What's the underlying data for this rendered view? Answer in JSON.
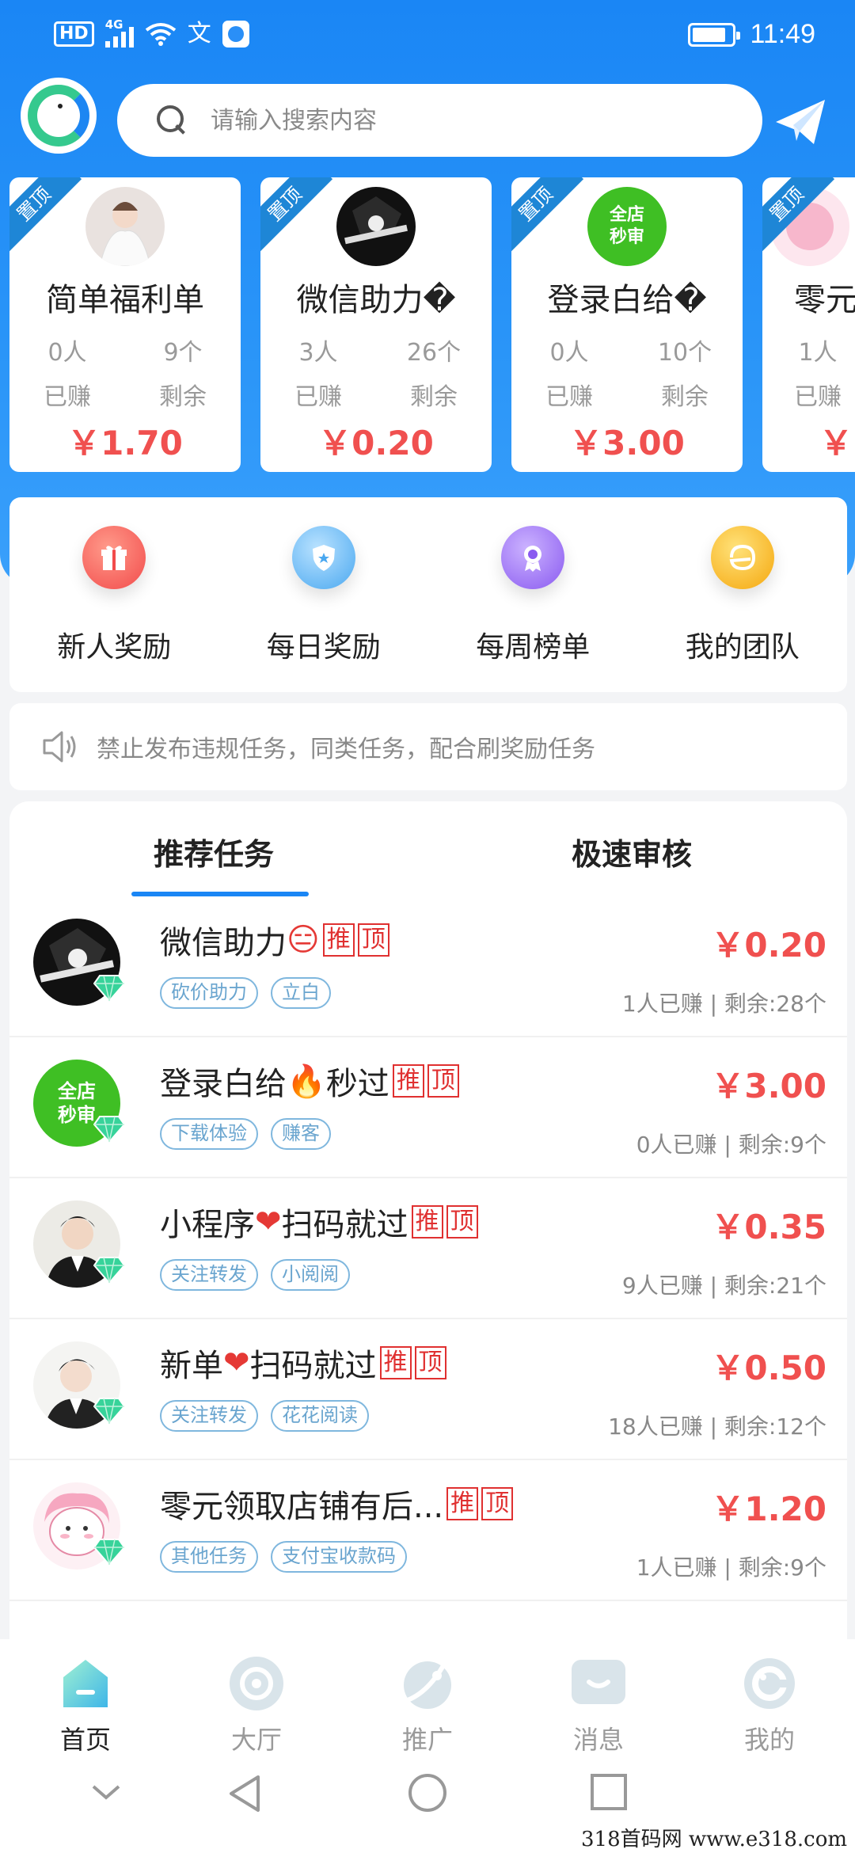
{
  "status_bar": {
    "hd": "HD",
    "network": "4G",
    "ime": "文",
    "time": "11:49",
    "battery_level": 0.85
  },
  "search": {
    "placeholder": "请输入搜索内容"
  },
  "top_cards": [
    {
      "ribbon": "置顶",
      "title": "简单福利单",
      "earned_count": "0人",
      "earned_label": "已赚",
      "remaining_count": "9个",
      "remaining_label": "剩余",
      "price": "￥1.70",
      "avatar": "girl-white-dress"
    },
    {
      "ribbon": "置顶",
      "title": "微信助力�",
      "earned_count": "3人",
      "earned_label": "已赚",
      "remaining_count": "26个",
      "remaining_label": "剩余",
      "price": "￥0.20",
      "avatar": "dark-anime"
    },
    {
      "ribbon": "置顶",
      "title": "登录白给�",
      "earned_count": "0人",
      "earned_label": "已赚",
      "remaining_count": "10个",
      "remaining_label": "剩余",
      "price": "￥3.00",
      "avatar": "green-badge"
    },
    {
      "ribbon": "置顶",
      "title": "零元",
      "earned_count": "1人",
      "earned_label": "已赚",
      "remaining_count": "",
      "remaining_label": "",
      "price": "￥",
      "avatar": "pink"
    }
  ],
  "avatar_badge_text": {
    "line1": "全店",
    "line2": "秒审"
  },
  "quick_menu": [
    {
      "label": "新人奖励",
      "icon": "gift-icon",
      "color": "#f55a5a"
    },
    {
      "label": "每日奖励",
      "icon": "shield-star-icon",
      "color": "#5fb6f5"
    },
    {
      "label": "每周榜单",
      "icon": "award-icon",
      "color": "#9b6cf2"
    },
    {
      "label": "我的团队",
      "icon": "team-icon",
      "color": "#f7b21a"
    }
  ],
  "notice": {
    "text": "禁止发布违规任务，同类任务，配合刷奖励任务"
  },
  "tabs": [
    {
      "label": "推荐任务",
      "active": true
    },
    {
      "label": "极速审核",
      "active": false
    }
  ],
  "task_flags": {
    "recommend": "推",
    "top": "顶"
  },
  "tasks": [
    {
      "title_before": "微信助力",
      "emoji": "😑",
      "title_after": "",
      "tags": [
        "砍价助力",
        "立白"
      ],
      "price": "￥0.20",
      "meta": "1人已赚 | 剩余:28个",
      "avatar": "dark-anime"
    },
    {
      "title_before": "登录白给",
      "emoji": "🔥",
      "title_after": "秒过",
      "tags": [
        "下载体验",
        "赚客"
      ],
      "price": "￥3.00",
      "meta": "0人已赚 | 剩余:9个",
      "avatar": "green-badge"
    },
    {
      "title_before": "小程序",
      "emoji": "❤",
      "title_after": "扫码就过",
      "tags": [
        "关注转发",
        "小阅阅"
      ],
      "price": "￥0.35",
      "meta": "9人已赚 | 剩余:21个",
      "avatar": "man-suit"
    },
    {
      "title_before": "新单",
      "emoji": "❤",
      "title_after": "扫码就过",
      "tags": [
        "关注转发",
        "花花阅读"
      ],
      "price": "￥0.50",
      "meta": "18人已赚 | 剩余:12个",
      "avatar": "man-suit-2"
    },
    {
      "title_before": "零元领取店铺有后...",
      "emoji": "",
      "title_after": "",
      "tags": [
        "其他任务",
        "支付宝收款码"
      ],
      "price": "￥1.20",
      "meta": "1人已赚 | 剩余:9个",
      "avatar": "pink"
    }
  ],
  "bottom_nav": [
    {
      "label": "首页",
      "icon": "home-icon",
      "active": true
    },
    {
      "label": "大厅",
      "icon": "hall-icon",
      "active": false
    },
    {
      "label": "推广",
      "icon": "promote-icon",
      "active": false
    },
    {
      "label": "消息",
      "icon": "message-icon",
      "active": false
    },
    {
      "label": "我的",
      "icon": "profile-icon",
      "active": false
    }
  ],
  "watermark": "318首码网  www.e318.com"
}
